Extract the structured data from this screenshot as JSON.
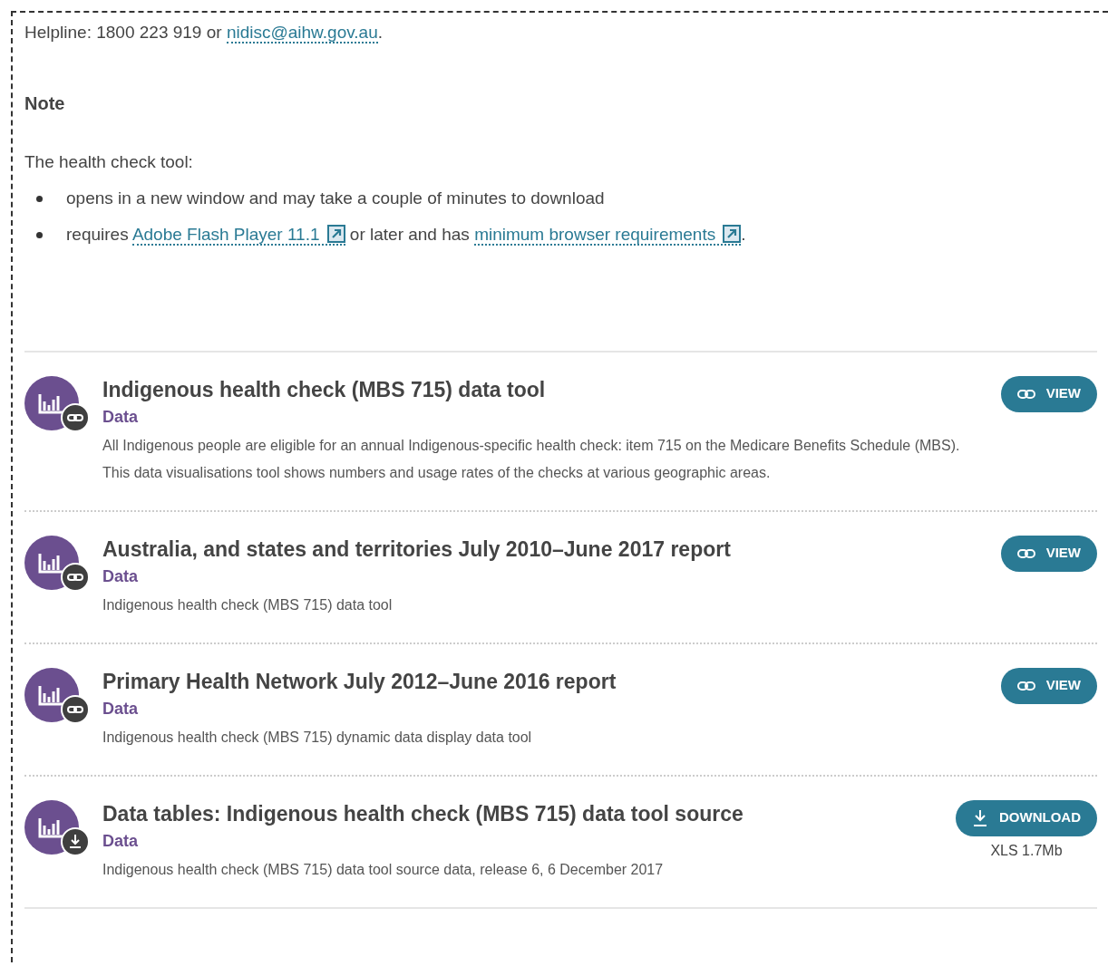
{
  "helpline": [
    {
      "kind": "text",
      "text": "Helpline: 1800 223 919 or "
    },
    {
      "kind": "link",
      "text": "nidisc@aihw.gov.au"
    },
    {
      "kind": "text",
      "text": "."
    }
  ],
  "note_heading": "Note",
  "intro": "The health check tool:",
  "bullets": [
    [
      {
        "kind": "text",
        "text": "opens in a new window and may take a couple of minutes to download"
      }
    ],
    [
      {
        "kind": "text",
        "text": "requires "
      },
      {
        "kind": "external_link",
        "text": "Adobe Flash Player 11.1"
      },
      {
        "kind": "text",
        "text": " or later and has "
      },
      {
        "kind": "external_link",
        "text": "minimum browser requirements"
      },
      {
        "kind": "text",
        "text": "."
      }
    ]
  ],
  "items": [
    {
      "kind": "view",
      "title": "Indigenous health check (MBS 715) data tool",
      "category": "Data",
      "description": "All Indigenous people are eligible for an annual Indigenous-specific health check: item 715 on the Medicare Benefits Schedule (MBS). This data visualisations tool shows numbers and usage rates of the checks at various geographic areas.",
      "button": "VIEW"
    },
    {
      "kind": "view",
      "title": "Australia, and states and territories July 2010–June 2017 report",
      "category": "Data",
      "description": "Indigenous health check (MBS 715) data tool",
      "button": "VIEW"
    },
    {
      "kind": "view",
      "title": "Primary Health Network July 2012–June 2016 report",
      "category": "Data",
      "description": "Indigenous health check (MBS 715) dynamic data display data tool",
      "button": "VIEW"
    },
    {
      "kind": "download",
      "title": "Data tables: Indigenous health check (MBS 715) data tool source",
      "category": "Data",
      "description": "Indigenous health check (MBS 715) data tool source data, release 6, 6 December 2017",
      "button": "DOWNLOAD",
      "file_type": "XLS",
      "file_size": "1.7Mb"
    }
  ]
}
